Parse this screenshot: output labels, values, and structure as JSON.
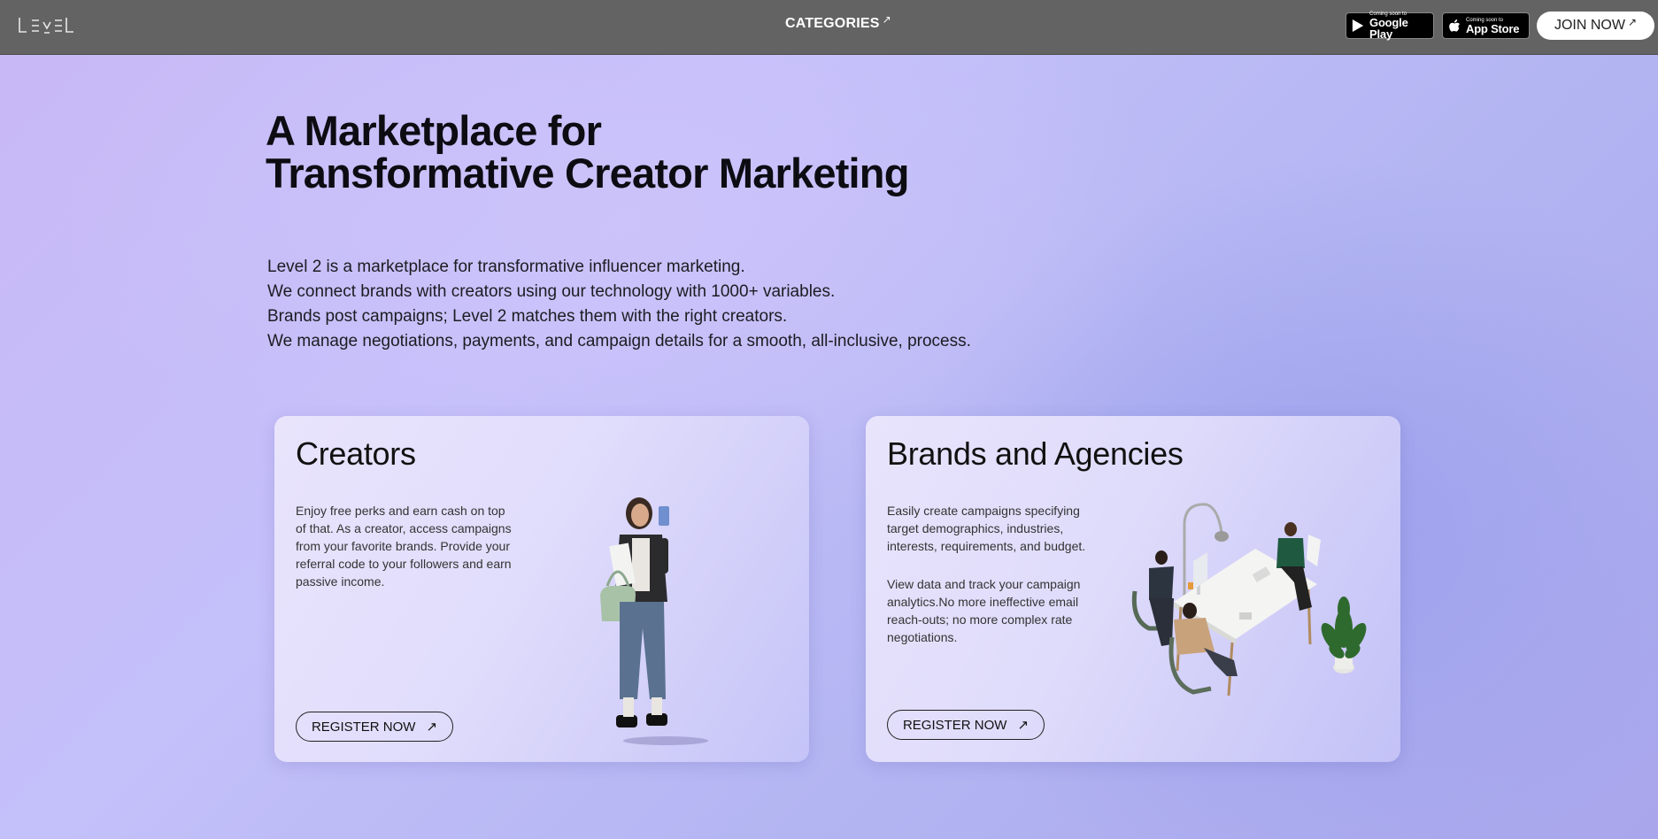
{
  "topbar": {
    "logo_text": "LEVEL",
    "categories_label": "CATEGORIES",
    "google_badge": {
      "small": "Coming soon to",
      "big": "Google Play"
    },
    "apple_badge": {
      "small": "Coming soon to",
      "big": "App Store"
    },
    "join_label": "JOIN NOW"
  },
  "hero": {
    "title_lines": [
      "A Marketplace for",
      "Transformative Creator Marketing"
    ],
    "desc_lines": [
      "Level 2 is a marketplace for transformative influencer marketing.",
      "We connect brands with creators using our technology with 1000+ variables.",
      "Brands post campaigns; Level 2 matches them with the right creators.",
      "We manage negotiations, payments, and campaign details for a smooth, all-inclusive, process."
    ]
  },
  "cards": {
    "creators": {
      "title": "Creators",
      "para": "Enjoy free perks and earn cash on top of that. As a creator, access campaigns from your favorite brands. Provide your referral code to your followers and earn passive income.",
      "button": "REGISTER NOW"
    },
    "brands": {
      "title": "Brands and Agencies",
      "para1": "Easily create campaigns specifying target demographics, industries, interests, requirements, and budget.",
      "para2": "View data and track your campaign analytics.No more ineffective email reach-outs; no more complex rate negotiations.",
      "button": "REGISTER NOW"
    }
  },
  "icons": {
    "arrow": "↗",
    "external_arrow": "north-east-arrow-icon"
  },
  "colors": {
    "topbar": "#636363",
    "background_start": "#c9b8f5",
    "background_end": "#a9a6ec"
  }
}
